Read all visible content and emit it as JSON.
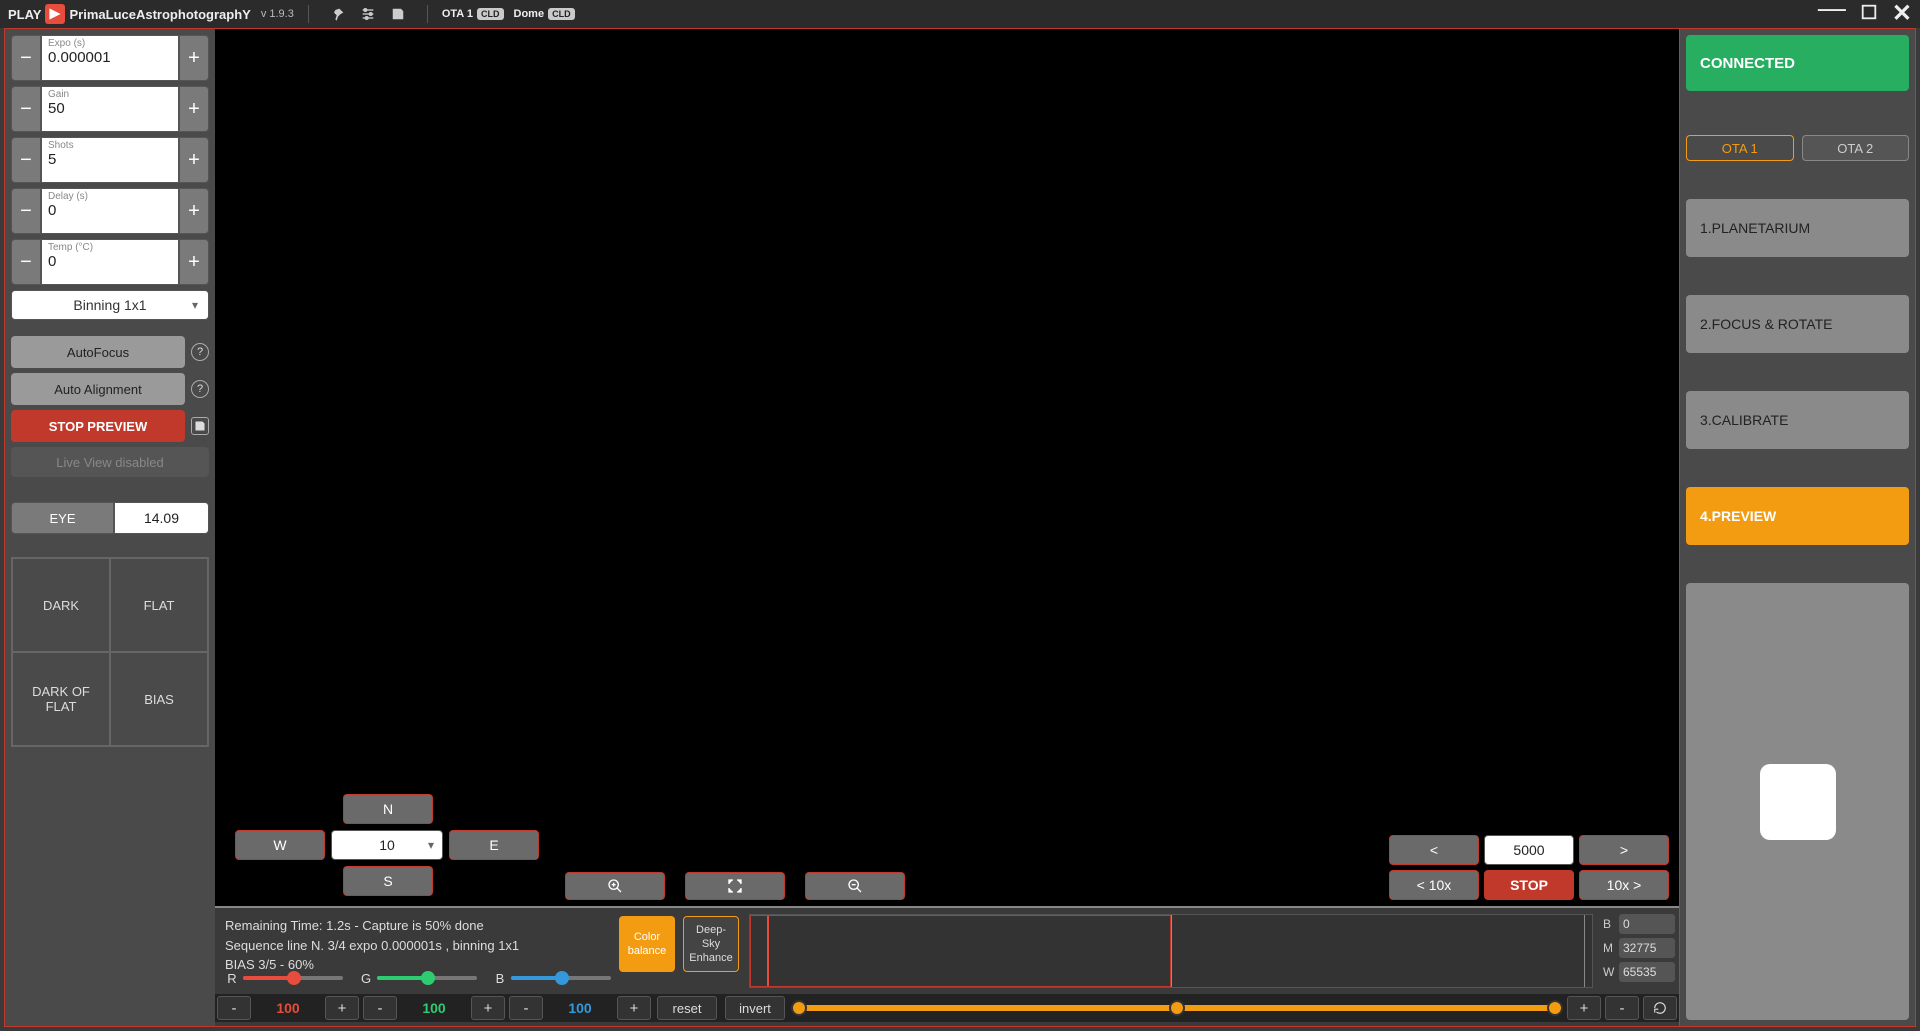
{
  "topbar": {
    "play": "PLAY",
    "brand_prefix": "P",
    "brand_mid": "rima",
    "brand_L": "L",
    "brand_uce": "uce",
    "brand_A": "A",
    "brand_rest": "strophotograph",
    "brand_Y": "Y",
    "version": "v 1.9.3",
    "ota1": "OTA 1",
    "ota1_badge": "CLD",
    "dome": "Dome",
    "dome_badge": "CLD"
  },
  "left": {
    "expo": {
      "label": "Expo (s)",
      "value": "0.000001"
    },
    "gain": {
      "label": "Gain",
      "value": "50"
    },
    "shots": {
      "label": "Shots",
      "value": "5"
    },
    "delay": {
      "label": "Delay (s)",
      "value": "0"
    },
    "temp": {
      "label": "Temp (°C)",
      "value": "0"
    },
    "binning": "Binning 1x1",
    "autofocus": "AutoFocus",
    "autoalign": "Auto Alignment",
    "stoppreview": "STOP PREVIEW",
    "liveview": "Live View disabled",
    "eye": "EYE",
    "eyeval": "14.09",
    "dark": "DARK",
    "flat": "FLAT",
    "darkflat": "DARK OF FLAT",
    "bias": "BIAS"
  },
  "dir": {
    "n": "N",
    "s": "S",
    "e": "E",
    "w": "W",
    "rate": "10"
  },
  "nudge": {
    "lt": "<",
    "gt": ">",
    "val": "5000",
    "lt10": "< 10x",
    "stop": "STOP",
    "gt10": "10x >"
  },
  "bottom": {
    "line1": "Remaining Time: 1.2s  -  Capture is 50% done",
    "line2": "Sequence line N. 3/4 expo 0.000001s , binning 1x1",
    "line3": "BIAS 3/5 - 60%",
    "r": "R",
    "g": "G",
    "b": "B",
    "rval": "100",
    "gval": "100",
    "bval": "100",
    "reset": "reset",
    "invert": "invert",
    "colorbal": "Color balance",
    "deepsky": "Deep-Sky Enhance",
    "Blab": "B",
    "Bval": "0",
    "Mlab": "M",
    "Mval": "32775",
    "Wlab": "W",
    "Wval": "65535"
  },
  "right": {
    "connected": "CONNECTED",
    "ota1": "OTA 1",
    "ota2": "OTA 2",
    "b1": "1.PLANETARIUM",
    "b2": "2.FOCUS & ROTATE",
    "b3": "3.CALIBRATE",
    "b4": "4.PREVIEW"
  }
}
